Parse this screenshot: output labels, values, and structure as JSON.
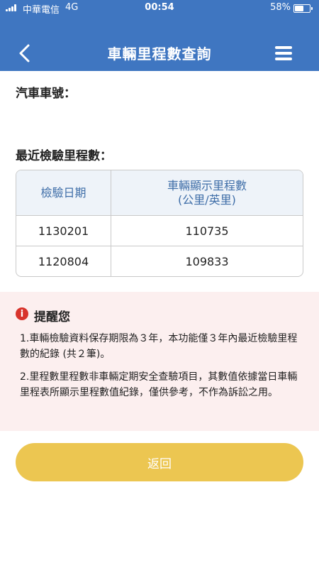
{
  "status_bar": {
    "carrier": "中華電信",
    "network": "4G",
    "time": "00:54",
    "battery_percent": "58%",
    "battery_level": 0.58
  },
  "header": {
    "title": "車輛里程數查詢",
    "back_icon": "chevron-left-icon",
    "menu_icon": "hamburger-menu-icon",
    "background_color": "#3f76c1"
  },
  "plate_label": "汽車車號：",
  "recent_label": "最近檢驗里程數：",
  "table": {
    "headers": [
      "檢驗日期",
      "車輛顯示里程數",
      "(公里/英里)"
    ],
    "rows": [
      [
        "1130201",
        "110735"
      ],
      [
        "1120804",
        "109833"
      ]
    ]
  },
  "reminder": {
    "title": "提醒您",
    "icon_text": "i",
    "notes": [
      "1.車輛檢驗資料保存期限為３年，本功能僅３年內最近檢驗里程數的紀錄 (共２筆)。",
      "2.里程數里程數非車輛定期安全查驗項目，其數值依據當日車輛里程表所顯示里程數值紀錄，僅供參考，不作為訴訟之用。"
    ],
    "background_color": "#fcefef",
    "icon_color": "#d8342c"
  },
  "return_button_label": "返回",
  "accent_yellow": "#ecc651"
}
